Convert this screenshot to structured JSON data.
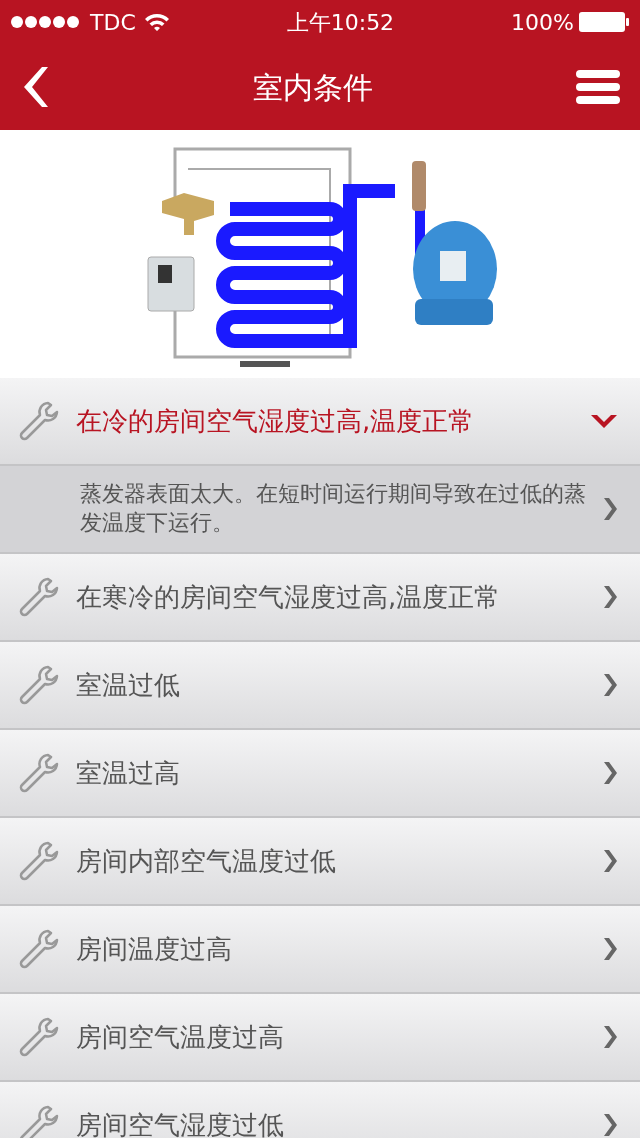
{
  "status_bar": {
    "carrier": "TDC",
    "time": "上午10:52",
    "battery": "100%"
  },
  "nav": {
    "title": "室内条件"
  },
  "items": [
    {
      "label": "在冷的房间空气湿度过高,温度正常",
      "expanded": true,
      "children": [
        {
          "label": "蒸发器表面太大。在短时间运行期间导致在过低的蒸发温度下运行。"
        }
      ]
    },
    {
      "label": "在寒冷的房间空气湿度过高,温度正常",
      "expanded": false
    },
    {
      "label": "室温过低",
      "expanded": false
    },
    {
      "label": "室温过高",
      "expanded": false
    },
    {
      "label": "房间内部空气温度过低",
      "expanded": false
    },
    {
      "label": "房间温度过高",
      "expanded": false
    },
    {
      "label": "房间空气温度过高",
      "expanded": false
    },
    {
      "label": "房间空气湿度过低",
      "expanded": false
    }
  ]
}
